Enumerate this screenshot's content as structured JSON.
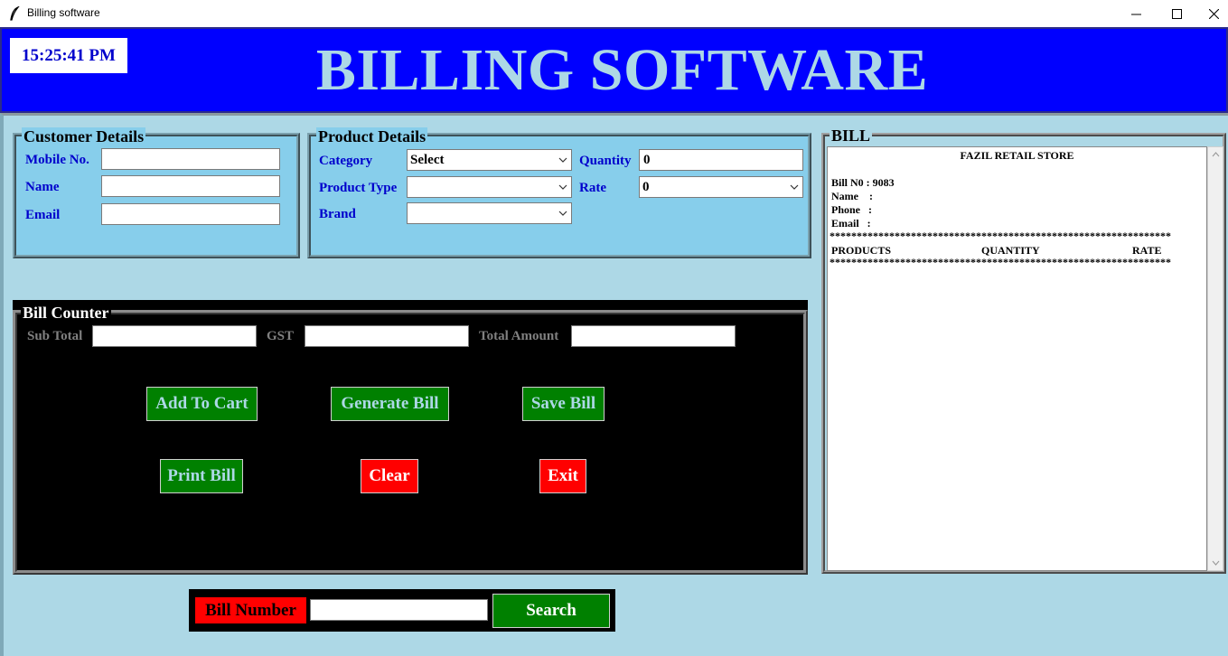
{
  "window": {
    "title": "Billing software",
    "icon": "feather-icon",
    "controls": [
      "minimize-icon",
      "maximize-icon",
      "close-icon"
    ]
  },
  "header": {
    "clock": "15:25:41 PM",
    "title": "BILLING SOFTWARE",
    "bg_color": "#0000ff",
    "title_color": "#add8e6"
  },
  "customer": {
    "frame_label": "Customer Details",
    "mobile_label": "Mobile No.",
    "mobile_value": "",
    "name_label": "Name",
    "name_value": "",
    "email_label": "Email",
    "email_value": ""
  },
  "product": {
    "frame_label": "Product Details",
    "category_label": "Category",
    "category_value": "Select",
    "product_type_label": "Product Type",
    "product_type_value": "",
    "brand_label": "Brand",
    "brand_value": "",
    "quantity_label": "Quantity",
    "quantity_value": "0",
    "rate_label": "Rate",
    "rate_value": "0"
  },
  "counter": {
    "frame_label": "Bill Counter",
    "subtotal_label": "Sub Total",
    "subtotal_value": "",
    "gst_label": "GST",
    "gst_value": "",
    "total_label": "Total Amount",
    "total_value": "",
    "buttons": {
      "add_to_cart": "Add To Cart",
      "generate_bill": "Generate Bill",
      "save_bill": "Save Bill",
      "print_bill": "Print Bill",
      "clear": "Clear",
      "exit": "Exit"
    }
  },
  "bill": {
    "frame_label": "BILL",
    "shop_name": "FAZIL RETAIL STORE",
    "bill_no": "Bill N0 : 9083",
    "name": "Name    :",
    "phone": "Phone   :",
    "email": "Email   :",
    "separator": "***************************************************************",
    "col_products": "PRODUCTS",
    "col_quantity": "QUANTITY",
    "col_rate": "RATE"
  },
  "search": {
    "label": "Bill Number",
    "value": "",
    "button": "Search"
  },
  "colors": {
    "panel_bg": "#add8e6",
    "frame_bg": "#87ceeb",
    "label_blue": "#0000cc",
    "button_green": "#008000",
    "button_red": "#ff0000"
  }
}
